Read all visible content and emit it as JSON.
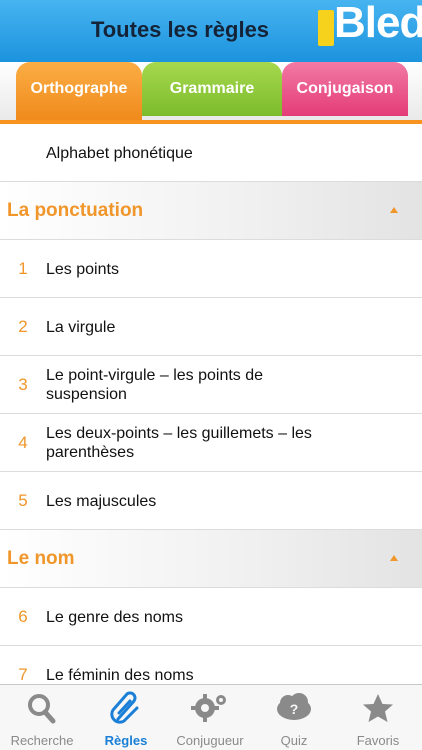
{
  "header": {
    "title": "Toutes les règles",
    "logo_text": "Bled",
    "logo_le": "le"
  },
  "tabs": [
    {
      "label": "Orthographe",
      "color": "#f08a1c",
      "active": true
    },
    {
      "label": "Grammaire",
      "color": "#7cbc2c",
      "active": false
    },
    {
      "label": "Conjugaison",
      "color": "#e43c77",
      "active": false
    }
  ],
  "list": {
    "intro": {
      "label": "Alphabet phonétique"
    },
    "sections": [
      {
        "title": "La ponctuation",
        "items": [
          {
            "num": "1",
            "label": "Les points"
          },
          {
            "num": "2",
            "label": "La virgule"
          },
          {
            "num": "3",
            "label": "Le point-virgule – les points de suspension"
          },
          {
            "num": "4",
            "label": "Les deux-points – les guillemets – les parenthèses"
          },
          {
            "num": "5",
            "label": "Les majuscules"
          }
        ]
      },
      {
        "title": "Le nom",
        "items": [
          {
            "num": "6",
            "label": "Le genre des noms"
          },
          {
            "num": "7",
            "label": "Le féminin des noms"
          }
        ]
      }
    ]
  },
  "tabbar": [
    {
      "label": "Recherche",
      "icon": "search-icon",
      "active": false
    },
    {
      "label": "Règles",
      "icon": "paperclip-icon",
      "active": true
    },
    {
      "label": "Conjugueur",
      "icon": "gears-icon",
      "active": false
    },
    {
      "label": "Quiz",
      "icon": "quiz-cloud-icon",
      "active": false
    },
    {
      "label": "Favoris",
      "icon": "star-icon",
      "active": false
    }
  ],
  "colors": {
    "accent_orange": "#f0962a",
    "header_blue": "#1c93de",
    "active_blue": "#1a7fd6"
  }
}
